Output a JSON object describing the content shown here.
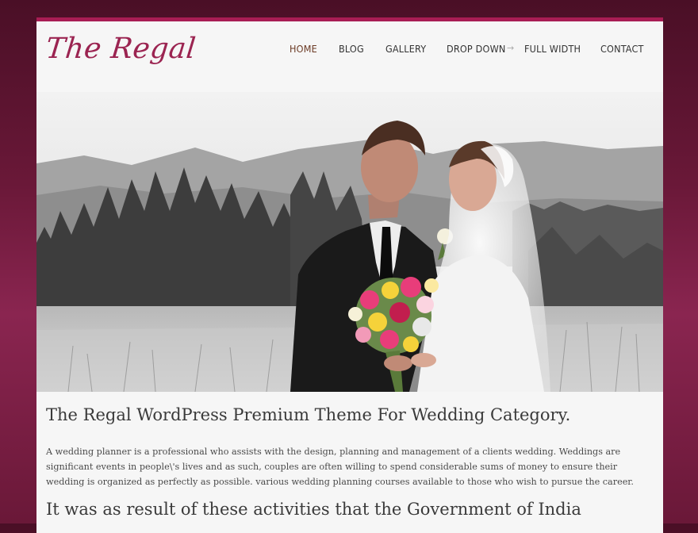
{
  "site": {
    "logo_text": "The Regal"
  },
  "nav": {
    "items": [
      {
        "label": "HOME",
        "active": true
      },
      {
        "label": "BLOG"
      },
      {
        "label": "GALLERY"
      },
      {
        "label": "DROP DOWN",
        "has_submenu": true
      },
      {
        "label": "FULL WIDTH"
      },
      {
        "label": "CONTACT"
      }
    ],
    "submenu_arrow": "→"
  },
  "post": {
    "title": "The Regal WordPress Premium Theme For Wedding Category.",
    "body": "A wedding planner is a professional who assists with the design, planning and management of a clients wedding. Weddings are significant events in people\\'s lives and as such, couples are often willing to spend considerable sums of money to ensure their wedding is organized as perfectly as possible. various wedding planning courses available to those who wish to pursue the career.",
    "subheading": "It was as result of these activities that the Government of India"
  },
  "colors": {
    "brand": "#9b2451",
    "accent_bar": "#a81d54",
    "background_dark": "#4a0f26"
  }
}
